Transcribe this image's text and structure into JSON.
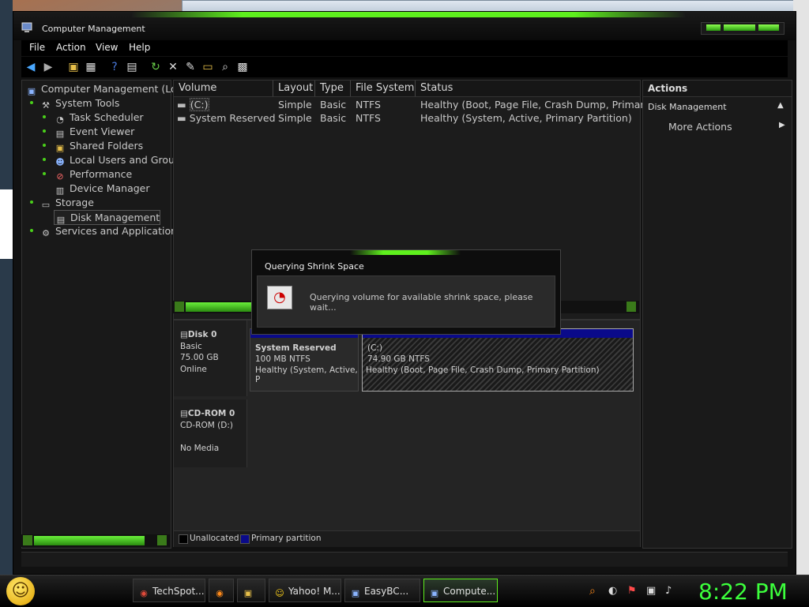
{
  "window": {
    "title": "Computer Management"
  },
  "menu": {
    "file": "File",
    "action": "Action",
    "view": "View",
    "help": "Help"
  },
  "tree": {
    "root": "Computer Management (Loc",
    "system_tools": "System Tools",
    "task_scheduler": "Task Scheduler",
    "event_viewer": "Event Viewer",
    "shared_folders": "Shared Folders",
    "local_users": "Local Users and Grou",
    "performance": "Performance",
    "device_manager": "Device Manager",
    "storage": "Storage",
    "disk_management": "Disk Management",
    "services": "Services and Applications"
  },
  "volumes": {
    "columns": [
      "Volume",
      "Layout",
      "Type",
      "File System",
      "Status"
    ],
    "rows": [
      {
        "volume": "(C:)",
        "layout": "Simple",
        "type": "Basic",
        "fs": "NTFS",
        "status": "Healthy (Boot, Page File, Crash Dump, Primary"
      },
      {
        "volume": "System Reserved",
        "layout": "Simple",
        "type": "Basic",
        "fs": "NTFS",
        "status": "Healthy (System, Active, Primary Partition)"
      }
    ]
  },
  "disks": {
    "disk0": {
      "name": "Disk 0",
      "type": "Basic",
      "size": "75.00 GB",
      "state": "Online"
    },
    "part_sr": {
      "name": "System Reserved",
      "size": "100 MB NTFS",
      "status": "Healthy (System, Active, P"
    },
    "part_c": {
      "name": "(C:)",
      "size": "74.90 GB NTFS",
      "status": "Healthy (Boot, Page File, Crash Dump, Primary Partition)"
    },
    "cdrom": {
      "name": "CD-ROM 0",
      "type": "CD-ROM (D:)",
      "state": "No Media"
    },
    "legend": {
      "unallocated": "Unallocated",
      "primary": "Primary partition"
    }
  },
  "actions": {
    "header": "Actions",
    "section": "Disk Management",
    "more": "More Actions"
  },
  "dialog": {
    "title": "Querying Shrink Space",
    "message": "Querying volume for available shrink space, please wait..."
  },
  "taskbar": {
    "items": [
      "TechSpot...",
      "",
      "",
      "Yahoo! M...",
      "EasyBC...",
      "Compute..."
    ],
    "clock": "8:22 PM"
  },
  "colors": {
    "accent": "#5ef01d",
    "partition_blue": "#0a0a8a",
    "clock": "#3cff3c"
  }
}
